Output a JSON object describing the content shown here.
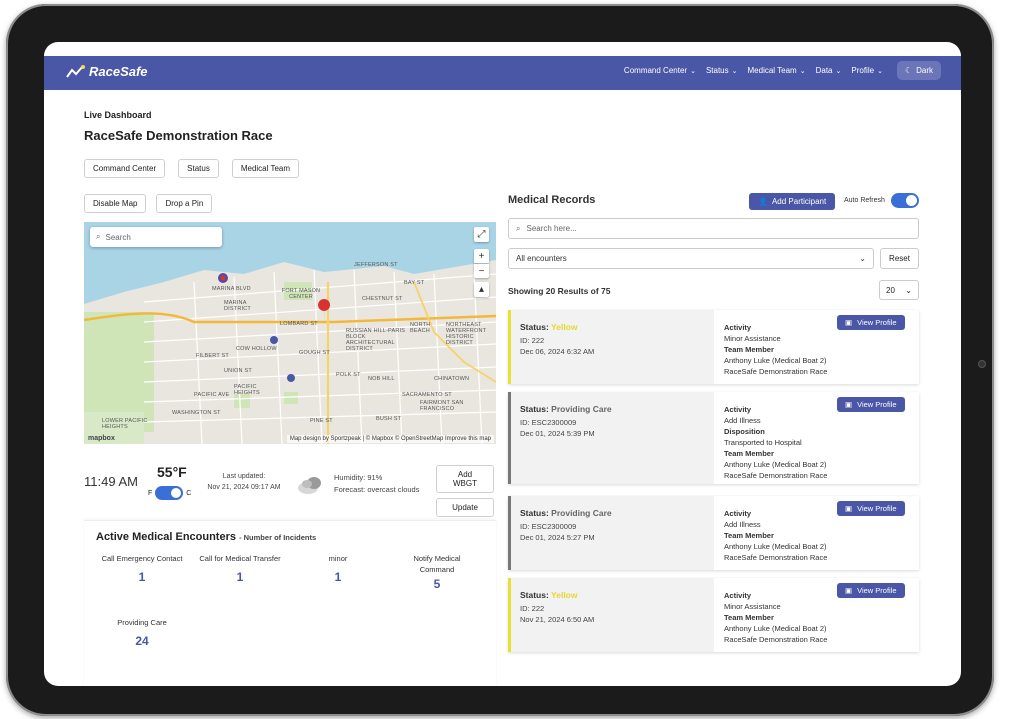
{
  "brand": {
    "name": "RaceSafe"
  },
  "nav": {
    "items": [
      {
        "label": "Command Center"
      },
      {
        "label": "Status"
      },
      {
        "label": "Medical Team"
      },
      {
        "label": "Data"
      },
      {
        "label": "Profile"
      }
    ],
    "theme_label": "Dark"
  },
  "page": {
    "breadcrumb": "Live Dashboard",
    "title": "RaceSafe Demonstration Race",
    "tabs": [
      "Command Center",
      "Status",
      "Medical Team"
    ]
  },
  "map": {
    "disable_label": "Disable Map",
    "pin_label": "Drop a Pin",
    "search_placeholder": "Search",
    "attribution": "Map design by Sportzpeak | © Mapbox © OpenStreetMap  Improve this map",
    "logo": "mapbox",
    "labels": [
      "Jefferson St",
      "Bay St",
      "Marina Blvd",
      "Fort Mason Center",
      "MARINA DISTRICT",
      "Chestnut St",
      "Lombard St",
      "RUSSIAN HILL-PARIS BLOCK ARCHITECTURAL DISTRICT",
      "NORTH BEACH",
      "NORTHEAST WATERFRONT HISTORIC DISTRICT",
      "COW HOLLOW",
      "Filbert St",
      "Union St",
      "Gough St",
      "Polk St",
      "NOB HILL",
      "CHINATOWN",
      "PACIFIC HEIGHTS",
      "Pacific Ave",
      "Washington St",
      "Sacramento St",
      "Fairmont San Francisco",
      "Bush St",
      "Pine St",
      "LOWER PACIFIC HEIGHTS"
    ]
  },
  "weather": {
    "time": "11:49 AM",
    "temp": "55°F",
    "unit_f": "F",
    "unit_c": "C",
    "updated_label": "Last updated:",
    "updated_value": "Nov 21, 2024 09:17 AM",
    "humidity": "Humidity: 91%",
    "forecast": "Forecast: overcast clouds",
    "add_wbgt": "Add WBGT",
    "update": "Update"
  },
  "encounters": {
    "title": "Active Medical Encounters",
    "subtitle": "- Number of Incidents",
    "items": [
      {
        "label": "Call Emergency Contact",
        "value": "1"
      },
      {
        "label": "Call for Medical Transfer",
        "value": "1"
      },
      {
        "label": "minor",
        "value": "1"
      },
      {
        "label": "Notify Medical Command",
        "value": "5"
      },
      {
        "label": "Providing Care",
        "value": "24"
      }
    ]
  },
  "records": {
    "title": "Medical Records",
    "add_label": "Add Participant",
    "auto_refresh": "Auto Refresh",
    "search_placeholder": "Search here...",
    "filter": "All encounters",
    "reset": "Reset",
    "showing": "Showing 20 Results of 75",
    "page_size": "20",
    "view_label": "View Profile",
    "cards": [
      {
        "status_label": "Status:",
        "status": "Yellow",
        "id": "ID: 222",
        "date": "Dec 06, 2024 6:32 AM",
        "lines": [
          [
            "Activity",
            true
          ],
          [
            "Minor Assistance",
            false
          ],
          [
            "Team Member",
            true
          ],
          [
            "Anthony Luke (Medical Boat 2)",
            false
          ],
          [
            "RaceSafe Demonstration Race",
            false
          ]
        ]
      },
      {
        "status_label": "Status:",
        "status": "Providing Care",
        "id": "ID: ESC2300009",
        "date": "Dec 01, 2024 5:39 PM",
        "lines": [
          [
            "Activity",
            true
          ],
          [
            "Add Illness",
            false
          ],
          [
            "Disposition",
            true
          ],
          [
            "Transported to Hospital",
            false
          ],
          [
            "Team Member",
            true
          ],
          [
            "Anthony Luke (Medical Boat 2)",
            false
          ],
          [
            "RaceSafe Demonstration Race",
            false
          ]
        ]
      },
      {
        "status_label": "Status:",
        "status": "Providing Care",
        "id": "ID: ESC2300009",
        "date": "Dec 01, 2024 5:27 PM",
        "lines": [
          [
            "Activity",
            true
          ],
          [
            "Add Illness",
            false
          ],
          [
            "Team Member",
            true
          ],
          [
            "Anthony Luke (Medical Boat 2)",
            false
          ],
          [
            "RaceSafe Demonstration Race",
            false
          ]
        ]
      },
      {
        "status_label": "Status:",
        "status": "Yellow",
        "id": "ID: 222",
        "date": "Nov 21, 2024 6:50 AM",
        "lines": [
          [
            "Activity",
            true
          ],
          [
            "Minor Assistance",
            false
          ],
          [
            "Team Member",
            true
          ],
          [
            "Anthony Luke (Medical Boat 2)",
            false
          ],
          [
            "RaceSafe Demonstration Race",
            false
          ]
        ]
      }
    ]
  },
  "colors": {
    "brand": "#4a56a6",
    "yellow": "#e6d630",
    "toggle": "#3a6fd8"
  }
}
